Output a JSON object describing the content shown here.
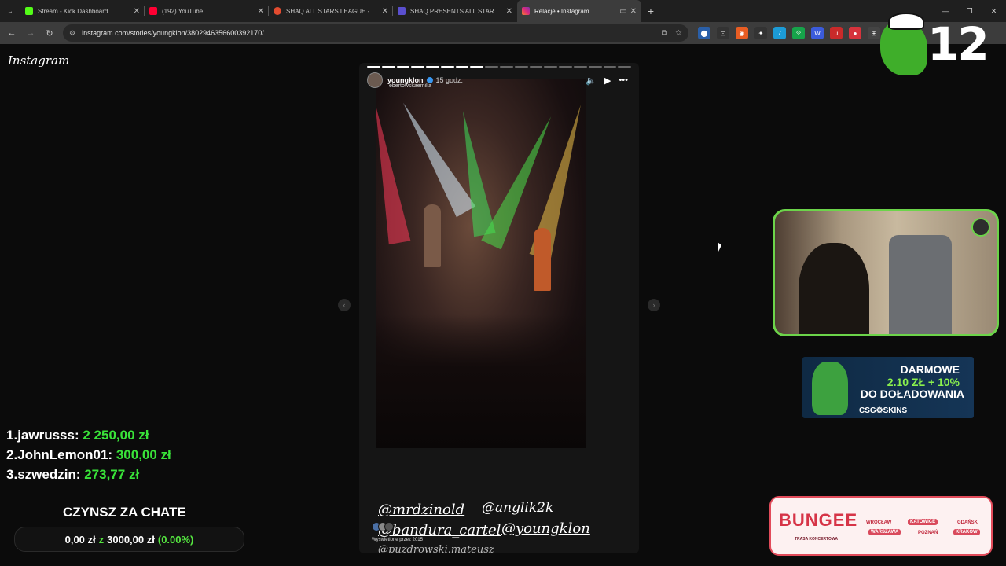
{
  "browser": {
    "tabs": [
      {
        "title": "Stream - Kick Dashboard",
        "color": "#53fc18"
      },
      {
        "title": "(192) YouTube",
        "color": "#ff0033"
      },
      {
        "title": "SHAQ ALL STARS LEAGUE -",
        "color": "#e24b2f"
      },
      {
        "title": "SHAQ PRESENTS ALL STARS LE",
        "color": "#5a4fcf"
      },
      {
        "title": "Relacje • Instagram",
        "color": "#d6249f"
      }
    ],
    "url": "instagram.com/stories/youngklon/3802946356600392170/"
  },
  "instagram": {
    "logo": "Instagram",
    "story": {
      "username": "youngklon",
      "time": "15 godz.",
      "repost_from": "ebertowskaemilia",
      "tags": [
        "@mrdzinold",
        "@anglik2k",
        "@bandura_cartel",
        "@youngklon",
        "@puzdrowski.mateusz"
      ],
      "views": "Wyświetlone przez 2015",
      "segments_total": 18,
      "segments_done": 8
    }
  },
  "stream": {
    "logo_number": "12",
    "donors": [
      {
        "rank": "1.",
        "name": "jawrusss:",
        "amount": "2 250,00 zł"
      },
      {
        "rank": "2.",
        "name": "JohnLemon01:",
        "amount": "300,00 zł"
      },
      {
        "rank": "3.",
        "name": "szwedzin:",
        "amount": "273,77 zł"
      }
    ],
    "rent": {
      "title": "CZYNSZ ZA CHATE",
      "current": "0,00 zł",
      "sep": "z",
      "goal": "3000,00 zł",
      "percent": "(0.00%)"
    },
    "ad_csg": {
      "line1": "DARMOWE",
      "line2": "2.10 ZŁ + 10%",
      "line3": "DO DOŁADOWANIA",
      "brand": "CSG⚙SKINS"
    },
    "ad_bungee": {
      "title": "BUNGEE",
      "subtitle": "TRASA KONCERTOWA",
      "cities": [
        "WROCŁAW",
        "KATOWICE",
        "GDAŃSK",
        "WARSZAWA",
        "POZNAŃ",
        "KRAKÓW"
      ]
    }
  }
}
